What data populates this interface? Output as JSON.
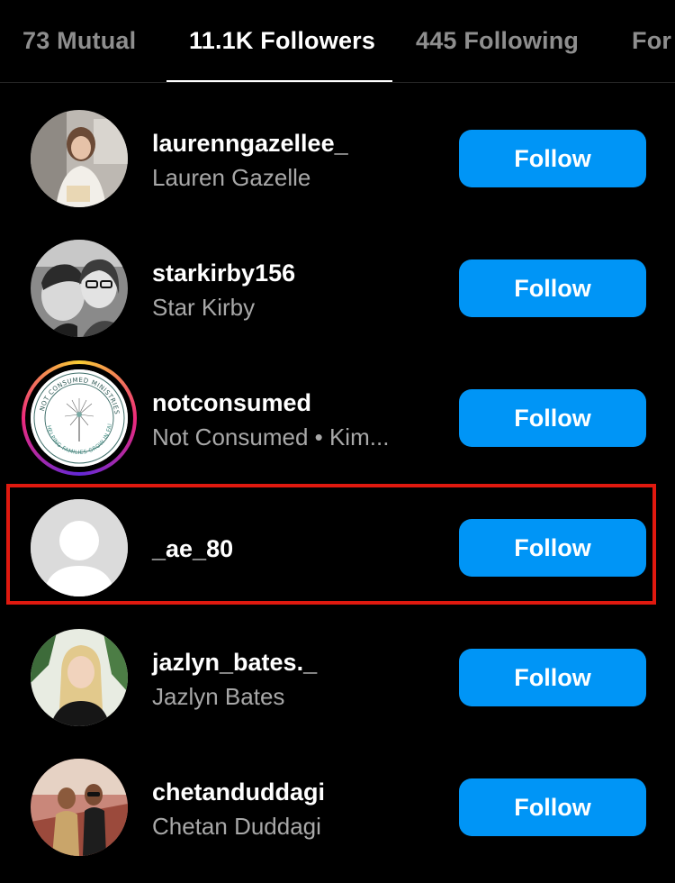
{
  "tabs": [
    {
      "label": "73 Mutual",
      "active": false
    },
    {
      "label": "11.1K Followers",
      "active": true
    },
    {
      "label": "445 Following",
      "active": false
    },
    {
      "label": "For",
      "active": false
    }
  ],
  "followers": [
    {
      "username": "laurenngazellee_",
      "full_name": "Lauren Gazelle",
      "button": "Follow",
      "avatar": "photo-avatar"
    },
    {
      "username": "starkirby156",
      "full_name": "Star Kirby",
      "button": "Follow",
      "avatar": "photo-avatar"
    },
    {
      "username": "notconsumed",
      "full_name": "Not Consumed • Kim...",
      "button": "Follow",
      "avatar": "logo-avatar",
      "avatar_text": "NOT CONSUMED MINISTRIES · HELPING FAMILIES GROW IN FAITH",
      "has_story_ring": true
    },
    {
      "username": "_ae_80",
      "full_name": "",
      "button": "Follow",
      "avatar": "default-avatar",
      "highlighted": true
    },
    {
      "username": "jazlyn_bates._",
      "full_name": "Jazlyn Bates",
      "button": "Follow",
      "avatar": "photo-avatar"
    },
    {
      "username": "chetanduddagi",
      "full_name": "Chetan Duddagi",
      "button": "Follow",
      "avatar": "photo-avatar"
    }
  ],
  "colors": {
    "background": "#000000",
    "follow_button": "#0095f6",
    "highlight": "#e0190f",
    "secondary_text": "#a8a8a8"
  }
}
